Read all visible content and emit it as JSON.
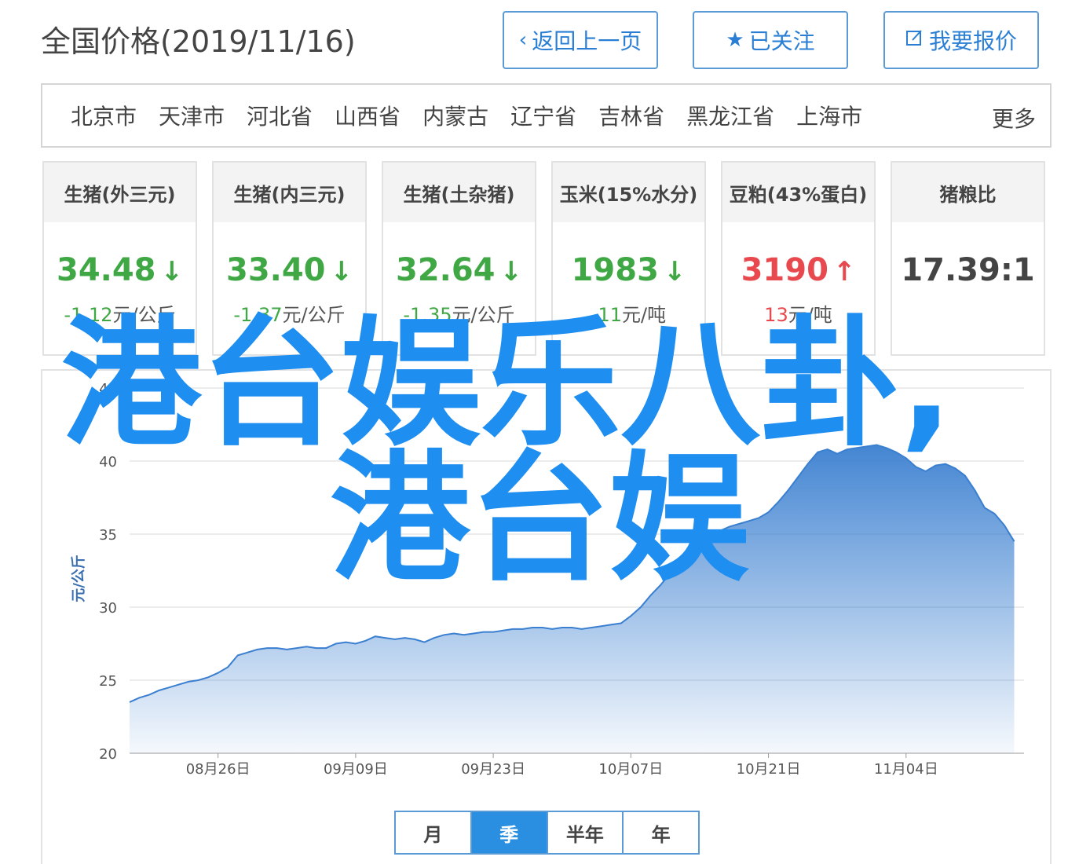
{
  "header": {
    "title": "全国价格(2019/11/16)",
    "back_label": "返回上一页",
    "follow_label": "已关注",
    "quote_label": "我要报价"
  },
  "regions": {
    "items": [
      "北京市",
      "天津市",
      "河北省",
      "山西省",
      "内蒙古",
      "辽宁省",
      "吉林省",
      "黑龙江省",
      "上海市"
    ],
    "more_label": "更多"
  },
  "cards": [
    {
      "name": "生猪(外三元)",
      "value": "34.48",
      "direction": "down",
      "change": "-1.12",
      "unit": "元/公斤"
    },
    {
      "name": "生猪(内三元)",
      "value": "33.40",
      "direction": "down",
      "change": "-1.37",
      "unit": "元/公斤"
    },
    {
      "name": "生猪(土杂猪)",
      "value": "32.64",
      "direction": "down",
      "change": "-1.35",
      "unit": "元/公斤"
    },
    {
      "name": "玉米(15%水分)",
      "value": "1983",
      "direction": "down",
      "change": "-11",
      "unit": "元/吨"
    },
    {
      "name": "豆粕(43%蛋白)",
      "value": "3190",
      "direction": "up",
      "change": "13",
      "unit": "元/吨"
    },
    {
      "name": "猪粮比",
      "value": "17.39:1",
      "direction": "none",
      "change": "",
      "unit": ""
    }
  ],
  "colors": {
    "down": "#3fa844",
    "up": "#e8494f",
    "accent": "#2a8fe0",
    "line": "#3a7fd0",
    "watermark": "#1e8ef0"
  },
  "range_tabs": {
    "items": [
      "月",
      "季",
      "半年",
      "年"
    ],
    "active": "季"
  },
  "watermark": {
    "line1": "港台娱乐八卦,",
    "line2": "港台娱"
  },
  "chart_data": {
    "type": "area",
    "ylabel": "元/公斤",
    "ylim": [
      20,
      45
    ],
    "yticks": [
      20,
      25,
      30,
      35,
      40,
      45
    ],
    "x_start": "2019-08-17",
    "x_end": "2019-11-16",
    "xtick_dates": [
      "2019-08-26",
      "2019-09-09",
      "2019-09-23",
      "2019-10-07",
      "2019-10-21",
      "2019-11-04"
    ],
    "xtick_labels": [
      "08月26日",
      "09月09日",
      "09月23日",
      "10月07日",
      "10月21日",
      "11月04日"
    ],
    "grid": true,
    "series": [
      {
        "dates": [
          "2019-08-17",
          "2019-08-18",
          "2019-08-19",
          "2019-08-20",
          "2019-08-21",
          "2019-08-22",
          "2019-08-23",
          "2019-08-24",
          "2019-08-25",
          "2019-08-26",
          "2019-08-27",
          "2019-08-28",
          "2019-08-29",
          "2019-08-30",
          "2019-08-31",
          "2019-09-01",
          "2019-09-02",
          "2019-09-03",
          "2019-09-04",
          "2019-09-05",
          "2019-09-06",
          "2019-09-07",
          "2019-09-08",
          "2019-09-09",
          "2019-09-10",
          "2019-09-11",
          "2019-09-12",
          "2019-09-13",
          "2019-09-14",
          "2019-09-15",
          "2019-09-16",
          "2019-09-17",
          "2019-09-18",
          "2019-09-19",
          "2019-09-20",
          "2019-09-21",
          "2019-09-22",
          "2019-09-23",
          "2019-09-24",
          "2019-09-25",
          "2019-09-26",
          "2019-09-27",
          "2019-09-28",
          "2019-09-29",
          "2019-09-30",
          "2019-10-01",
          "2019-10-02",
          "2019-10-03",
          "2019-10-04",
          "2019-10-05",
          "2019-10-06",
          "2019-10-07",
          "2019-10-08",
          "2019-10-09",
          "2019-10-10",
          "2019-10-11",
          "2019-10-12",
          "2019-10-13",
          "2019-10-14",
          "2019-10-15",
          "2019-10-16",
          "2019-10-17",
          "2019-10-18",
          "2019-10-19",
          "2019-10-20",
          "2019-10-21",
          "2019-10-22",
          "2019-10-23",
          "2019-10-24",
          "2019-10-25",
          "2019-10-26",
          "2019-10-27",
          "2019-10-28",
          "2019-10-29",
          "2019-10-30",
          "2019-10-31",
          "2019-11-01",
          "2019-11-02",
          "2019-11-03",
          "2019-11-04",
          "2019-11-05",
          "2019-11-06",
          "2019-11-07",
          "2019-11-08",
          "2019-11-09",
          "2019-11-10",
          "2019-11-11",
          "2019-11-12",
          "2019-11-13",
          "2019-11-14",
          "2019-11-15"
        ],
        "values": [
          23.5,
          23.8,
          24.0,
          24.3,
          24.5,
          24.7,
          24.9,
          25.0,
          25.2,
          25.5,
          25.9,
          26.7,
          26.9,
          27.1,
          27.2,
          27.2,
          27.1,
          27.2,
          27.3,
          27.2,
          27.2,
          27.5,
          27.6,
          27.5,
          27.7,
          28.0,
          27.9,
          27.8,
          27.9,
          27.8,
          27.6,
          27.9,
          28.1,
          28.2,
          28.1,
          28.2,
          28.3,
          28.3,
          28.4,
          28.5,
          28.5,
          28.6,
          28.6,
          28.5,
          28.6,
          28.6,
          28.5,
          28.6,
          28.7,
          28.8,
          28.9,
          29.4,
          30.0,
          30.8,
          31.5,
          32.3,
          33.0,
          33.6,
          34.2,
          34.8,
          35.2,
          35.5,
          35.7,
          35.9,
          36.1,
          36.5,
          37.2,
          38.0,
          38.9,
          39.8,
          40.6,
          40.8,
          40.5,
          40.8,
          40.9,
          41.0,
          41.1,
          40.9,
          40.6,
          40.2,
          39.6,
          39.3,
          39.7,
          39.8,
          39.5,
          39.0,
          38.0,
          36.8,
          36.4,
          35.6,
          34.5
        ]
      }
    ]
  }
}
